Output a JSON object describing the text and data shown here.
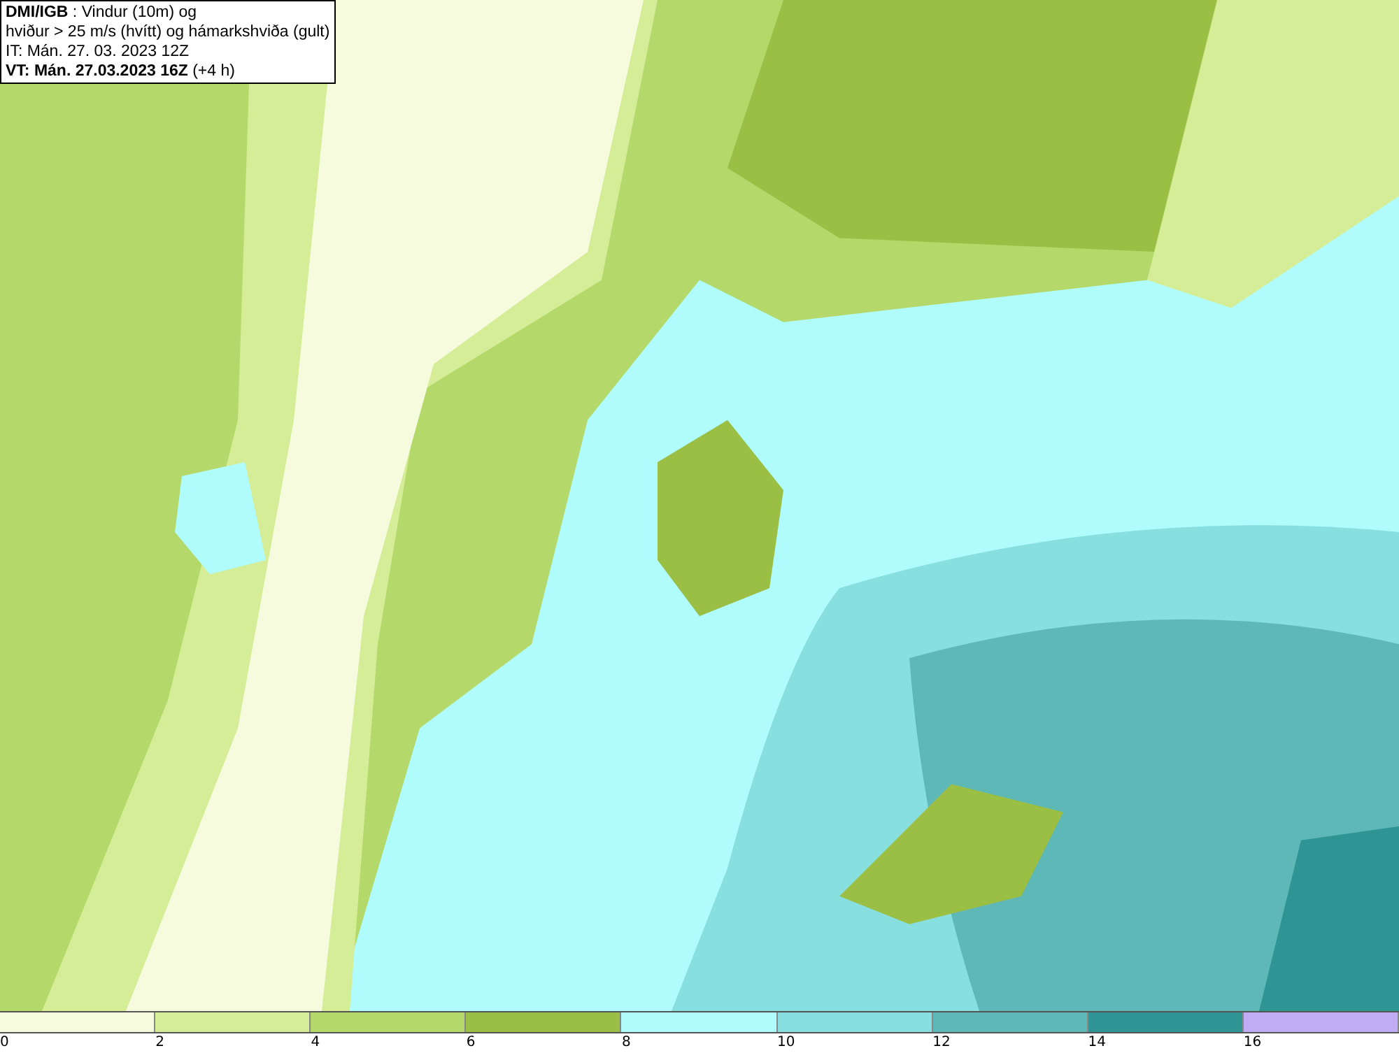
{
  "title_box": {
    "lines": [
      "**DMI/IGB** : Vindur (10m) og",
      "hviður > 25 m/s (hvítt) og hámarkshviða (gult)",
      "IT: Mán. 27. 03. 2023 12Z",
      "**VT: Mán. 27.03.2023 16Z** (+4 h)"
    ]
  },
  "legend": [
    {
      "label": "0",
      "color": "#f5fbdc"
    },
    {
      "label": "2",
      "color": "#d4ed96"
    },
    {
      "label": "4",
      "color": "#b5d86a"
    },
    {
      "label": "6",
      "color": "#9bbf45"
    },
    {
      "label": "8",
      "color": "#b0fcfc"
    },
    {
      "label": "10",
      "color": "#88dfe0"
    },
    {
      "label": "12",
      "color": "#5fb8b8"
    },
    {
      "label": "14",
      "color": "#2e9494"
    },
    {
      "label": "16",
      "color": "#c0acf5"
    }
  ]
}
